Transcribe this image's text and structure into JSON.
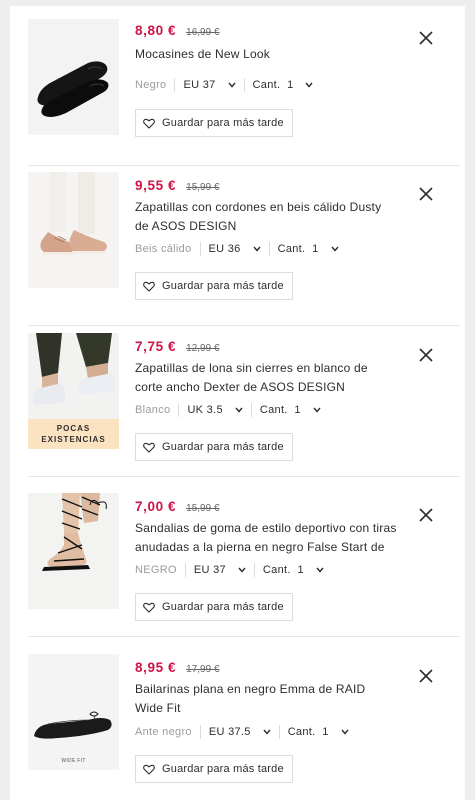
{
  "items": [
    {
      "price": "8,80 €",
      "was_price": "16,99 €",
      "name": "Mocasines de New Look",
      "colour": "Negro",
      "size": "EU 37",
      "qty_label": "Cant.",
      "qty": "1",
      "save_label": "Guardar para más tarde",
      "badge": ""
    },
    {
      "price": "9,55 €",
      "was_price": "15,99 €",
      "name": "Zapatillas con cordones en beis cálido Dusty de ASOS DESIGN",
      "colour": "Beis cálido",
      "size": "EU 36",
      "qty_label": "Cant.",
      "qty": "1",
      "save_label": "Guardar para más tarde",
      "badge": ""
    },
    {
      "price": "7,75 €",
      "was_price": "12,99 €",
      "name": "Zapatillas de lona sin cierres en blanco de corte ancho Dexter de ASOS DESIGN",
      "colour": "Blanco",
      "size": "UK 3.5",
      "qty_label": "Cant.",
      "qty": "1",
      "save_label": "Guardar para más tarde",
      "badge": "POCAS EXISTENCIAS"
    },
    {
      "price": "7,00 €",
      "was_price": "15,99 €",
      "name": "Sandalias de goma de estilo deportivo con tiras anudadas a la pierna en negro False Start de",
      "colour": "NEGRO",
      "size": "EU 37",
      "qty_label": "Cant.",
      "qty": "1",
      "save_label": "Guardar para más tarde",
      "badge": ""
    },
    {
      "price": "8,95 €",
      "was_price": "17,99 €",
      "name": "Bailarinas plana en negro Emma de RAID Wide Fit",
      "colour": "Ante negro",
      "size": "EU 37.5",
      "qty_label": "Cant.",
      "qty": "1",
      "save_label": "Guardar para más tarde",
      "badge": "",
      "image_caption": "WIDE FIT"
    }
  ],
  "icons": {
    "remove": "close-icon",
    "save": "heart-icon",
    "dropdown": "chevron-down-icon"
  },
  "colors": {
    "sale_price": "#d01345",
    "low_stock_badge": "#fbe3c2"
  }
}
